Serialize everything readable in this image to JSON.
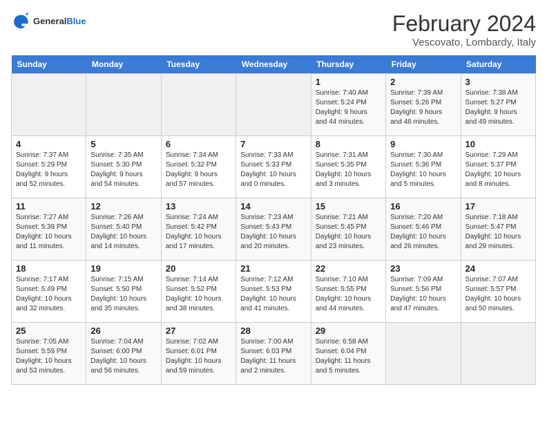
{
  "header": {
    "title": "February 2024",
    "location": "Vescovato, Lombardy, Italy",
    "logo_general": "General",
    "logo_blue": "Blue"
  },
  "weekdays": [
    "Sunday",
    "Monday",
    "Tuesday",
    "Wednesday",
    "Thursday",
    "Friday",
    "Saturday"
  ],
  "weeks": [
    [
      {
        "day": "",
        "info": ""
      },
      {
        "day": "",
        "info": ""
      },
      {
        "day": "",
        "info": ""
      },
      {
        "day": "",
        "info": ""
      },
      {
        "day": "1",
        "info": "Sunrise: 7:40 AM\nSunset: 5:24 PM\nDaylight: 9 hours\nand 44 minutes."
      },
      {
        "day": "2",
        "info": "Sunrise: 7:39 AM\nSunset: 5:26 PM\nDaylight: 9 hours\nand 46 minutes."
      },
      {
        "day": "3",
        "info": "Sunrise: 7:38 AM\nSunset: 5:27 PM\nDaylight: 9 hours\nand 49 minutes."
      }
    ],
    [
      {
        "day": "4",
        "info": "Sunrise: 7:37 AM\nSunset: 5:29 PM\nDaylight: 9 hours\nand 52 minutes."
      },
      {
        "day": "5",
        "info": "Sunrise: 7:35 AM\nSunset: 5:30 PM\nDaylight: 9 hours\nand 54 minutes."
      },
      {
        "day": "6",
        "info": "Sunrise: 7:34 AM\nSunset: 5:32 PM\nDaylight: 9 hours\nand 57 minutes."
      },
      {
        "day": "7",
        "info": "Sunrise: 7:33 AM\nSunset: 5:33 PM\nDaylight: 10 hours\nand 0 minutes."
      },
      {
        "day": "8",
        "info": "Sunrise: 7:31 AM\nSunset: 5:35 PM\nDaylight: 10 hours\nand 3 minutes."
      },
      {
        "day": "9",
        "info": "Sunrise: 7:30 AM\nSunset: 5:36 PM\nDaylight: 10 hours\nand 5 minutes."
      },
      {
        "day": "10",
        "info": "Sunrise: 7:29 AM\nSunset: 5:37 PM\nDaylight: 10 hours\nand 8 minutes."
      }
    ],
    [
      {
        "day": "11",
        "info": "Sunrise: 7:27 AM\nSunset: 5:39 PM\nDaylight: 10 hours\nand 11 minutes."
      },
      {
        "day": "12",
        "info": "Sunrise: 7:26 AM\nSunset: 5:40 PM\nDaylight: 10 hours\nand 14 minutes."
      },
      {
        "day": "13",
        "info": "Sunrise: 7:24 AM\nSunset: 5:42 PM\nDaylight: 10 hours\nand 17 minutes."
      },
      {
        "day": "14",
        "info": "Sunrise: 7:23 AM\nSunset: 5:43 PM\nDaylight: 10 hours\nand 20 minutes."
      },
      {
        "day": "15",
        "info": "Sunrise: 7:21 AM\nSunset: 5:45 PM\nDaylight: 10 hours\nand 23 minutes."
      },
      {
        "day": "16",
        "info": "Sunrise: 7:20 AM\nSunset: 5:46 PM\nDaylight: 10 hours\nand 26 minutes."
      },
      {
        "day": "17",
        "info": "Sunrise: 7:18 AM\nSunset: 5:47 PM\nDaylight: 10 hours\nand 29 minutes."
      }
    ],
    [
      {
        "day": "18",
        "info": "Sunrise: 7:17 AM\nSunset: 5:49 PM\nDaylight: 10 hours\nand 32 minutes."
      },
      {
        "day": "19",
        "info": "Sunrise: 7:15 AM\nSunset: 5:50 PM\nDaylight: 10 hours\nand 35 minutes."
      },
      {
        "day": "20",
        "info": "Sunrise: 7:14 AM\nSunset: 5:52 PM\nDaylight: 10 hours\nand 38 minutes."
      },
      {
        "day": "21",
        "info": "Sunrise: 7:12 AM\nSunset: 5:53 PM\nDaylight: 10 hours\nand 41 minutes."
      },
      {
        "day": "22",
        "info": "Sunrise: 7:10 AM\nSunset: 5:55 PM\nDaylight: 10 hours\nand 44 minutes."
      },
      {
        "day": "23",
        "info": "Sunrise: 7:09 AM\nSunset: 5:56 PM\nDaylight: 10 hours\nand 47 minutes."
      },
      {
        "day": "24",
        "info": "Sunrise: 7:07 AM\nSunset: 5:57 PM\nDaylight: 10 hours\nand 50 minutes."
      }
    ],
    [
      {
        "day": "25",
        "info": "Sunrise: 7:05 AM\nSunset: 5:59 PM\nDaylight: 10 hours\nand 53 minutes."
      },
      {
        "day": "26",
        "info": "Sunrise: 7:04 AM\nSunset: 6:00 PM\nDaylight: 10 hours\nand 56 minutes."
      },
      {
        "day": "27",
        "info": "Sunrise: 7:02 AM\nSunset: 6:01 PM\nDaylight: 10 hours\nand 59 minutes."
      },
      {
        "day": "28",
        "info": "Sunrise: 7:00 AM\nSunset: 6:03 PM\nDaylight: 11 hours\nand 2 minutes."
      },
      {
        "day": "29",
        "info": "Sunrise: 6:58 AM\nSunset: 6:04 PM\nDaylight: 11 hours\nand 5 minutes."
      },
      {
        "day": "",
        "info": ""
      },
      {
        "day": "",
        "info": ""
      }
    ]
  ]
}
